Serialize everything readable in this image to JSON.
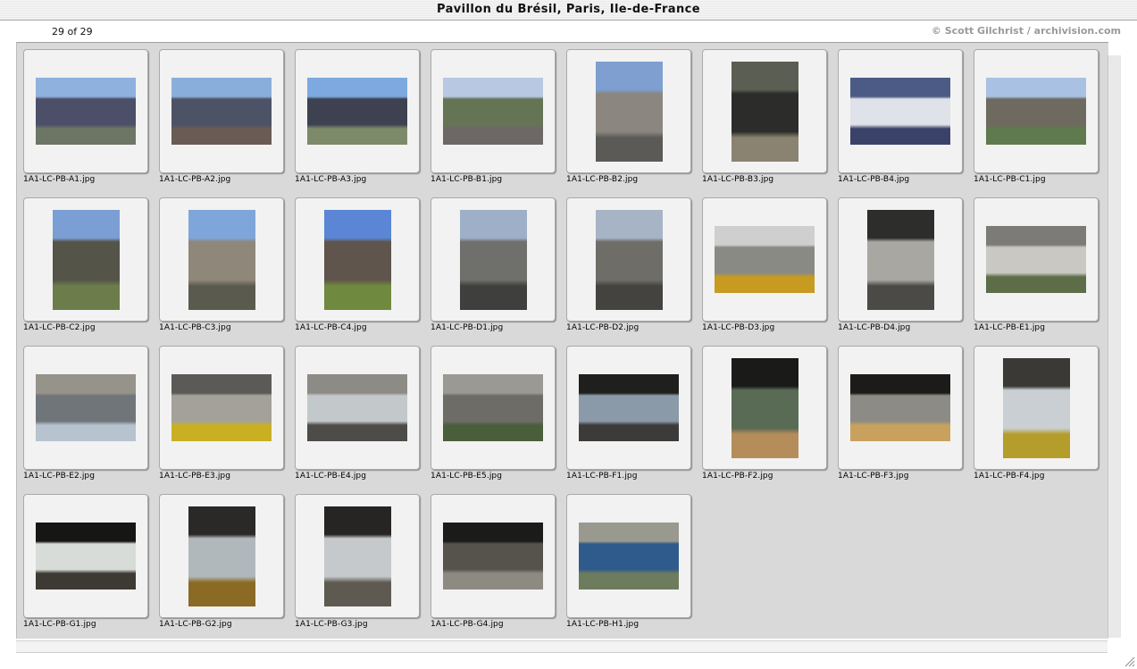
{
  "window": {
    "title": "Pavillon du Brésil, Paris, Ile-de-France"
  },
  "info": {
    "count": "29 of 29",
    "copyright": "© Scott Gilchrist / archivision.com"
  },
  "thumbnails": [
    {
      "file": "1A1-LC-PB-A1.jpg",
      "orientation": "landscape",
      "colors": [
        "#8fb1dd",
        "#4c4f68",
        "#6d7665"
      ]
    },
    {
      "file": "1A1-LC-PB-A2.jpg",
      "orientation": "landscape",
      "colors": [
        "#8aaedb",
        "#4d5367",
        "#6a5b55"
      ]
    },
    {
      "file": "1A1-LC-PB-A3.jpg",
      "orientation": "landscape",
      "colors": [
        "#7da9e0",
        "#3e4250",
        "#7d8a6a"
      ]
    },
    {
      "file": "1A1-LC-PB-B1.jpg",
      "orientation": "landscape",
      "colors": [
        "#b8c8e2",
        "#657455",
        "#6d6866"
      ]
    },
    {
      "file": "1A1-LC-PB-B2.jpg",
      "orientation": "portrait",
      "colors": [
        "#7e9fd0",
        "#8b8780",
        "#5c5a57"
      ]
    },
    {
      "file": "1A1-LC-PB-B3.jpg",
      "orientation": "portrait",
      "colors": [
        "#5b5e52",
        "#2c2d2a",
        "#8a8371"
      ]
    },
    {
      "file": "1A1-LC-PB-B4.jpg",
      "orientation": "landscape",
      "colors": [
        "#4c5a86",
        "#dfe2e8",
        "#3a4269"
      ]
    },
    {
      "file": "1A1-LC-PB-C1.jpg",
      "orientation": "landscape",
      "colors": [
        "#a9c2e4",
        "#6e6a5f",
        "#5f7a4d"
      ]
    },
    {
      "file": "1A1-LC-PB-C2.jpg",
      "orientation": "portrait",
      "colors": [
        "#7b9ed4",
        "#545449",
        "#6c7c4a"
      ]
    },
    {
      "file": "1A1-LC-PB-C3.jpg",
      "orientation": "portrait",
      "colors": [
        "#7ea6da",
        "#8f877a",
        "#5a5b4e"
      ]
    },
    {
      "file": "1A1-LC-PB-C4.jpg",
      "orientation": "portrait",
      "colors": [
        "#5a86d5",
        "#5f554c",
        "#6f8a3e"
      ]
    },
    {
      "file": "1A1-LC-PB-D1.jpg",
      "orientation": "portrait",
      "colors": [
        "#9eb0c8",
        "#6f6f6c",
        "#3f3f3d"
      ]
    },
    {
      "file": "1A1-LC-PB-D2.jpg",
      "orientation": "portrait",
      "colors": [
        "#a7b4c6",
        "#6e6d68",
        "#444340"
      ]
    },
    {
      "file": "1A1-LC-PB-D3.jpg",
      "orientation": "landscape",
      "colors": [
        "#cfcfcf",
        "#8a8a85",
        "#c79a22"
      ]
    },
    {
      "file": "1A1-LC-PB-D4.jpg",
      "orientation": "portrait",
      "colors": [
        "#2d2d2b",
        "#a8a7a1",
        "#4b4a46"
      ]
    },
    {
      "file": "1A1-LC-PB-E1.jpg",
      "orientation": "landscape",
      "colors": [
        "#7c7b77",
        "#c9c8c2",
        "#5c6d48"
      ]
    },
    {
      "file": "1A1-LC-PB-E2.jpg",
      "orientation": "landscape",
      "colors": [
        "#96938b",
        "#70757a",
        "#b7c3cf"
      ]
    },
    {
      "file": "1A1-LC-PB-E3.jpg",
      "orientation": "landscape",
      "colors": [
        "#5b5a56",
        "#a3a19a",
        "#c9b023"
      ]
    },
    {
      "file": "1A1-LC-PB-E4.jpg",
      "orientation": "landscape",
      "colors": [
        "#8d8b86",
        "#c3c8cb",
        "#4d4c49"
      ]
    },
    {
      "file": "1A1-LC-PB-E5.jpg",
      "orientation": "landscape",
      "colors": [
        "#9b9993",
        "#6d6c67",
        "#4b5e3c"
      ]
    },
    {
      "file": "1A1-LC-PB-F1.jpg",
      "orientation": "landscape",
      "colors": [
        "#1f1f1e",
        "#8a9aa8",
        "#3c3b39"
      ]
    },
    {
      "file": "1A1-LC-PB-F2.jpg",
      "orientation": "portrait",
      "colors": [
        "#1a1a19",
        "#596a55",
        "#b58d5a"
      ]
    },
    {
      "file": "1A1-LC-PB-F3.jpg",
      "orientation": "landscape",
      "colors": [
        "#1c1b1a",
        "#8c8b86",
        "#c9a15e"
      ]
    },
    {
      "file": "1A1-LC-PB-F4.jpg",
      "orientation": "portrait",
      "colors": [
        "#3b3935",
        "#c9cfd3",
        "#b49d2a"
      ]
    },
    {
      "file": "1A1-LC-PB-G1.jpg",
      "orientation": "landscape",
      "colors": [
        "#161615",
        "#d8dcd9",
        "#3d3a33"
      ]
    },
    {
      "file": "1A1-LC-PB-G2.jpg",
      "orientation": "portrait",
      "colors": [
        "#2a2927",
        "#b1b8bc",
        "#8b6a25"
      ]
    },
    {
      "file": "1A1-LC-PB-G3.jpg",
      "orientation": "portrait",
      "colors": [
        "#262523",
        "#c5c9cb",
        "#5e5a52"
      ]
    },
    {
      "file": "1A1-LC-PB-G4.jpg",
      "orientation": "landscape",
      "colors": [
        "#1b1b1a",
        "#56534c",
        "#8d8a82"
      ]
    },
    {
      "file": "1A1-LC-PB-H1.jpg",
      "orientation": "landscape",
      "colors": [
        "#9a998f",
        "#2f5b8c",
        "#6c7c5d"
      ]
    }
  ]
}
